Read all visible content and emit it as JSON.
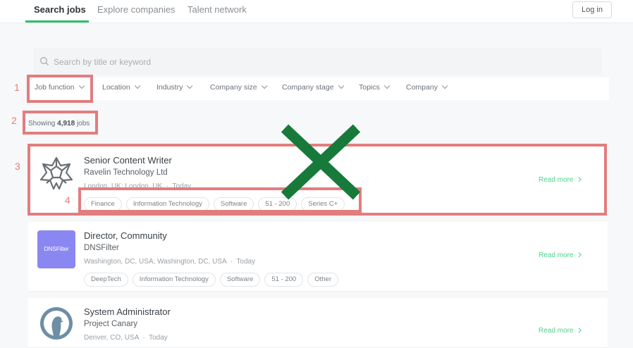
{
  "nav": {
    "tabs": [
      "Search jobs",
      "Explore companies",
      "Talent network"
    ],
    "login": "Log in"
  },
  "search": {
    "placeholder": "Search by title or keyword"
  },
  "filters": [
    "Job function",
    "Location",
    "Industry",
    "Company size",
    "Company stage",
    "Topics",
    "Company"
  ],
  "results": {
    "prefix": "Showing ",
    "count": "4,918",
    "suffix": " jobs"
  },
  "jobs": [
    {
      "title": "Senior Content Writer",
      "company": "Ravelin Technology Ltd",
      "location": "London, UK; London, UK",
      "posted": "Today",
      "tags": [
        "Finance",
        "Information Technology",
        "Software",
        "51 - 200",
        "Series C+"
      ],
      "read_more": "Read more",
      "logo_icon": "star-lattice-logo-icon"
    },
    {
      "title": "Director, Community",
      "company": "DNSFilter",
      "location": "Washington, DC, USA; Washington, DC, USA",
      "posted": "Today",
      "tags": [
        "DeepTech",
        "Information Technology",
        "Software",
        "51 - 200",
        "Other"
      ],
      "read_more": "Read more",
      "logo_text": "DNSFilter",
      "logo_color": "#8b87f2"
    },
    {
      "title": "System Administrator",
      "company": "Project Canary",
      "location": "Denver, CO, USA",
      "posted": "Today",
      "read_more": "Read more",
      "logo_icon": "bird-silhouette-logo-icon",
      "logo_color": "#6c8fa5"
    }
  ],
  "annotations": [
    "1",
    "2",
    "3",
    "4"
  ],
  "colors": {
    "accent": "#2bbf6a",
    "annotation": "#e27d7e",
    "cross": "#177a3a"
  }
}
